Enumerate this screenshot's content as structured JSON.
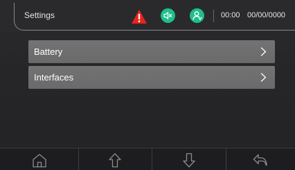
{
  "header": {
    "title": "Settings",
    "time": "00:00",
    "date": "00/00/0000",
    "icons": [
      "warning-icon",
      "speaker-mute-icon",
      "user-icon"
    ],
    "colors": {
      "warning": "#e8231c",
      "status_green": "#1fbf8a"
    }
  },
  "menu": {
    "items": [
      {
        "label": "Battery",
        "icon": "chevron-right-icon"
      },
      {
        "label": "Interfaces",
        "icon": "chevron-right-icon"
      }
    ]
  },
  "footer": {
    "buttons": [
      {
        "icon": "home-icon"
      },
      {
        "icon": "arrow-up-icon"
      },
      {
        "icon": "arrow-down-icon"
      },
      {
        "icon": "back-icon"
      }
    ]
  }
}
